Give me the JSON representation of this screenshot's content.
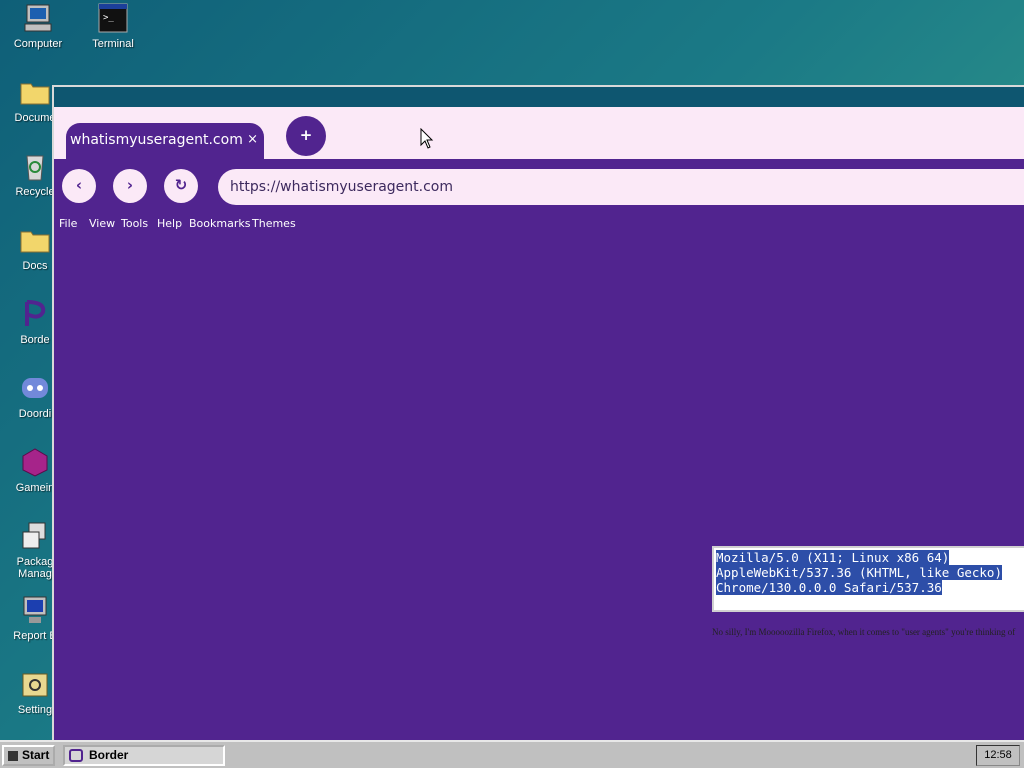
{
  "desktop": {
    "icons": [
      {
        "label": "Computer",
        "icon": "computer-icon"
      },
      {
        "label": "Terminal",
        "icon": "terminal-icon"
      },
      {
        "label": "Docume",
        "icon": "folder-icon"
      },
      {
        "label": "Recycle",
        "icon": "recycle-bin-icon"
      },
      {
        "label": "Docs",
        "icon": "folder-icon"
      },
      {
        "label": "Borde",
        "icon": "border-browser-icon"
      },
      {
        "label": "Doordi",
        "icon": "discord-icon"
      },
      {
        "label": "Gamein",
        "icon": "game-icon"
      },
      {
        "label": "Packag Manag",
        "icon": "package-manager-icon"
      },
      {
        "label": "Report B",
        "icon": "report-icon"
      },
      {
        "label": "Setting",
        "icon": "settings-icon"
      }
    ]
  },
  "browser": {
    "tab": {
      "title": "whatismyuseragent.com",
      "close": "×"
    },
    "new_tab": "+",
    "nav": {
      "back": "‹",
      "forward": "›",
      "reload": "↻"
    },
    "url": "https://whatismyuseragent.com",
    "menu": [
      "File",
      "View",
      "Tools",
      "Help",
      "Bookmarks",
      "Themes"
    ],
    "page": {
      "ua_lines": [
        "Mozilla/5.0 (X11; Linux x86 64)",
        "AppleWebKit/537.36 (KHTML, like Gecko)",
        "Chrome/130.0.0.0 Safari/537.36"
      ],
      "footnote": "No silly, I'm Mooooozilla Firefox, when it comes to \"user agents\" you're thinking of"
    }
  },
  "taskbar": {
    "start_label": "Start",
    "task_label": "Border",
    "clock": "12:58"
  },
  "colors": {
    "browser_bg": "#51248f",
    "tab_strip": "#fbe9f7",
    "desktop": "#1b7a86"
  }
}
